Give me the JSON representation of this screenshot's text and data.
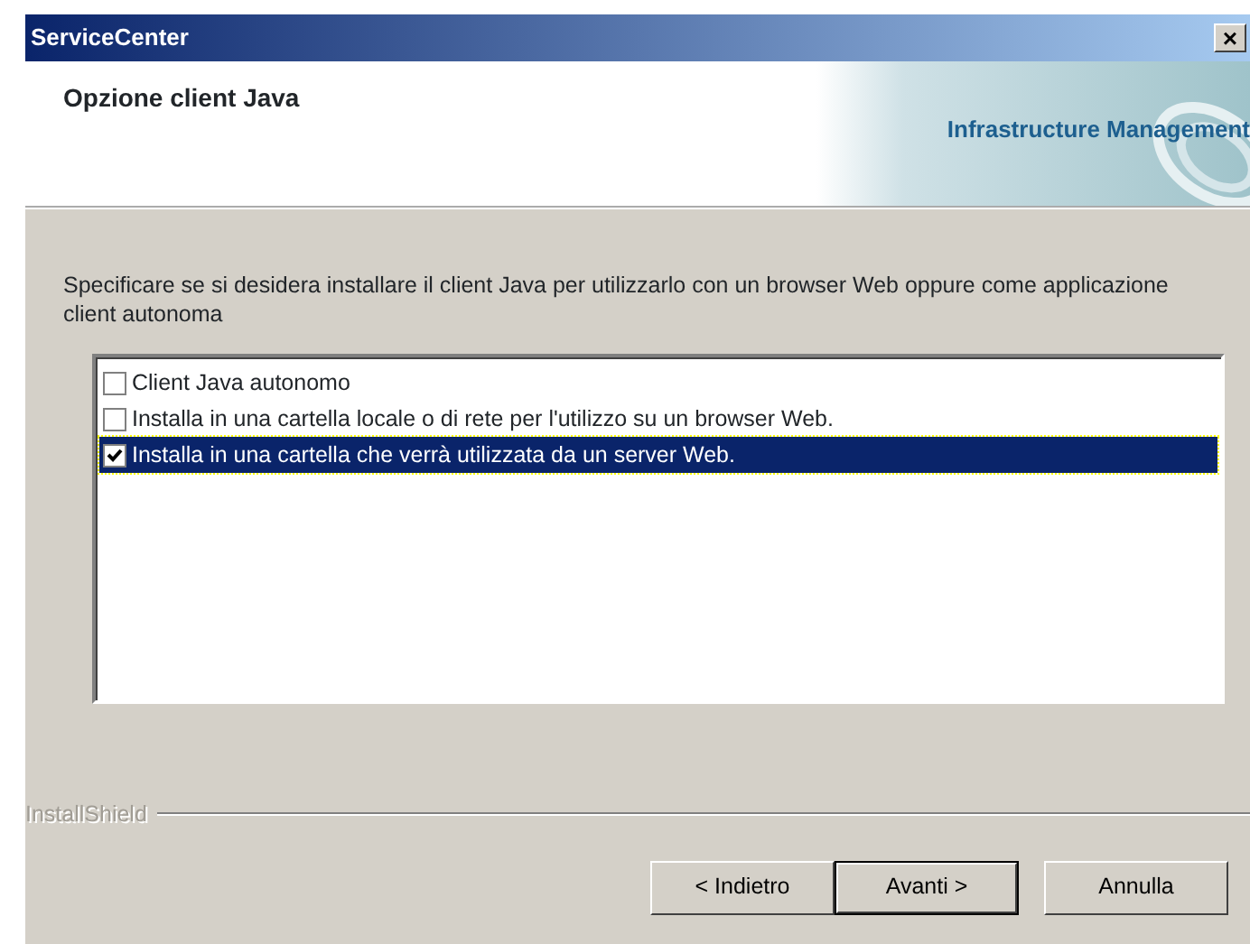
{
  "window": {
    "title": "ServiceCenter",
    "close": "×"
  },
  "header": {
    "title": "Opzione client Java",
    "brand": "Infrastructure Management"
  },
  "description": "Specificare se si desidera installare il client Java per utilizzarlo con un browser Web oppure come applicazione client autonoma",
  "options": [
    {
      "label": "Client Java autonomo",
      "checked": false,
      "selected": false
    },
    {
      "label": "Installa in una cartella locale o di rete per l'utilizzo su un browser Web.",
      "checked": false,
      "selected": false
    },
    {
      "label": "Installa in una cartella che verrà utilizzata da un server Web.",
      "checked": true,
      "selected": true
    }
  ],
  "footer_label": "InstallShield",
  "buttons": [
    {
      "label": "< Indietro",
      "default": false
    },
    {
      "label": "Avanti >",
      "default": true
    },
    {
      "label": "Annulla",
      "default": false
    }
  ]
}
